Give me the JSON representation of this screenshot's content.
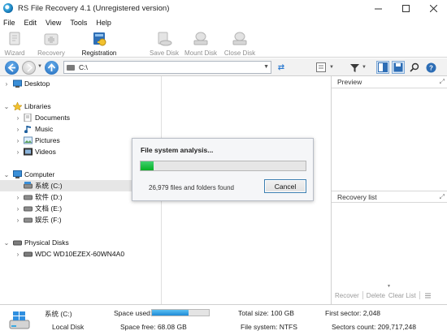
{
  "window": {
    "title": "RS File Recovery 4.1 (Unregistered version)",
    "controls": [
      "minimize",
      "maximize",
      "close"
    ]
  },
  "menu": [
    "File",
    "Edit",
    "View",
    "Tools",
    "Help"
  ],
  "ribbon": {
    "wizard": "Wizard",
    "recovery": "Recovery",
    "registration": "Registration",
    "save_disk": "Save Disk",
    "mount_disk": "Mount Disk",
    "close_disk": "Close Disk"
  },
  "address": {
    "value": "C:\\"
  },
  "tree": {
    "desktop": "Desktop",
    "libraries": "Libraries",
    "documents": "Documents",
    "music": "Music",
    "pictures": "Pictures",
    "videos": "Videos",
    "computer": "Computer",
    "drive_c": "系统 (C:)",
    "drive_d": "软件 (D:)",
    "drive_e": "文档 (E:)",
    "drive_f": "娱乐 (F:)",
    "physical_disks": "Physical Disks",
    "wdc": "WDC WD10EZEX-60WN4A0"
  },
  "preview": {
    "title": "Preview"
  },
  "recovery_list": {
    "title": "Recovery list",
    "recover": "Recover",
    "delete": "Delete",
    "clear_list": "Clear List"
  },
  "dialog": {
    "title": "File system analysis...",
    "progress": 0.08,
    "status": "26,979 files and folders found",
    "cancel": "Cancel"
  },
  "status": {
    "drive_name": "系统 (C:)",
    "drive_type": "Local Disk",
    "space_used_label": "Space used:",
    "space_used_fraction": 0.64,
    "space_free": "Space free: 68.08 GB",
    "total_size": "Total size: 100 GB",
    "file_system": "File system: NTFS",
    "first_sector": "First sector: 2,048",
    "sectors_count": "Sectors count: 209,717,248"
  },
  "colors": {
    "accent_blue": "#1f8ad6",
    "progress_green": "#06b025",
    "selection": "#e6e6e6"
  }
}
